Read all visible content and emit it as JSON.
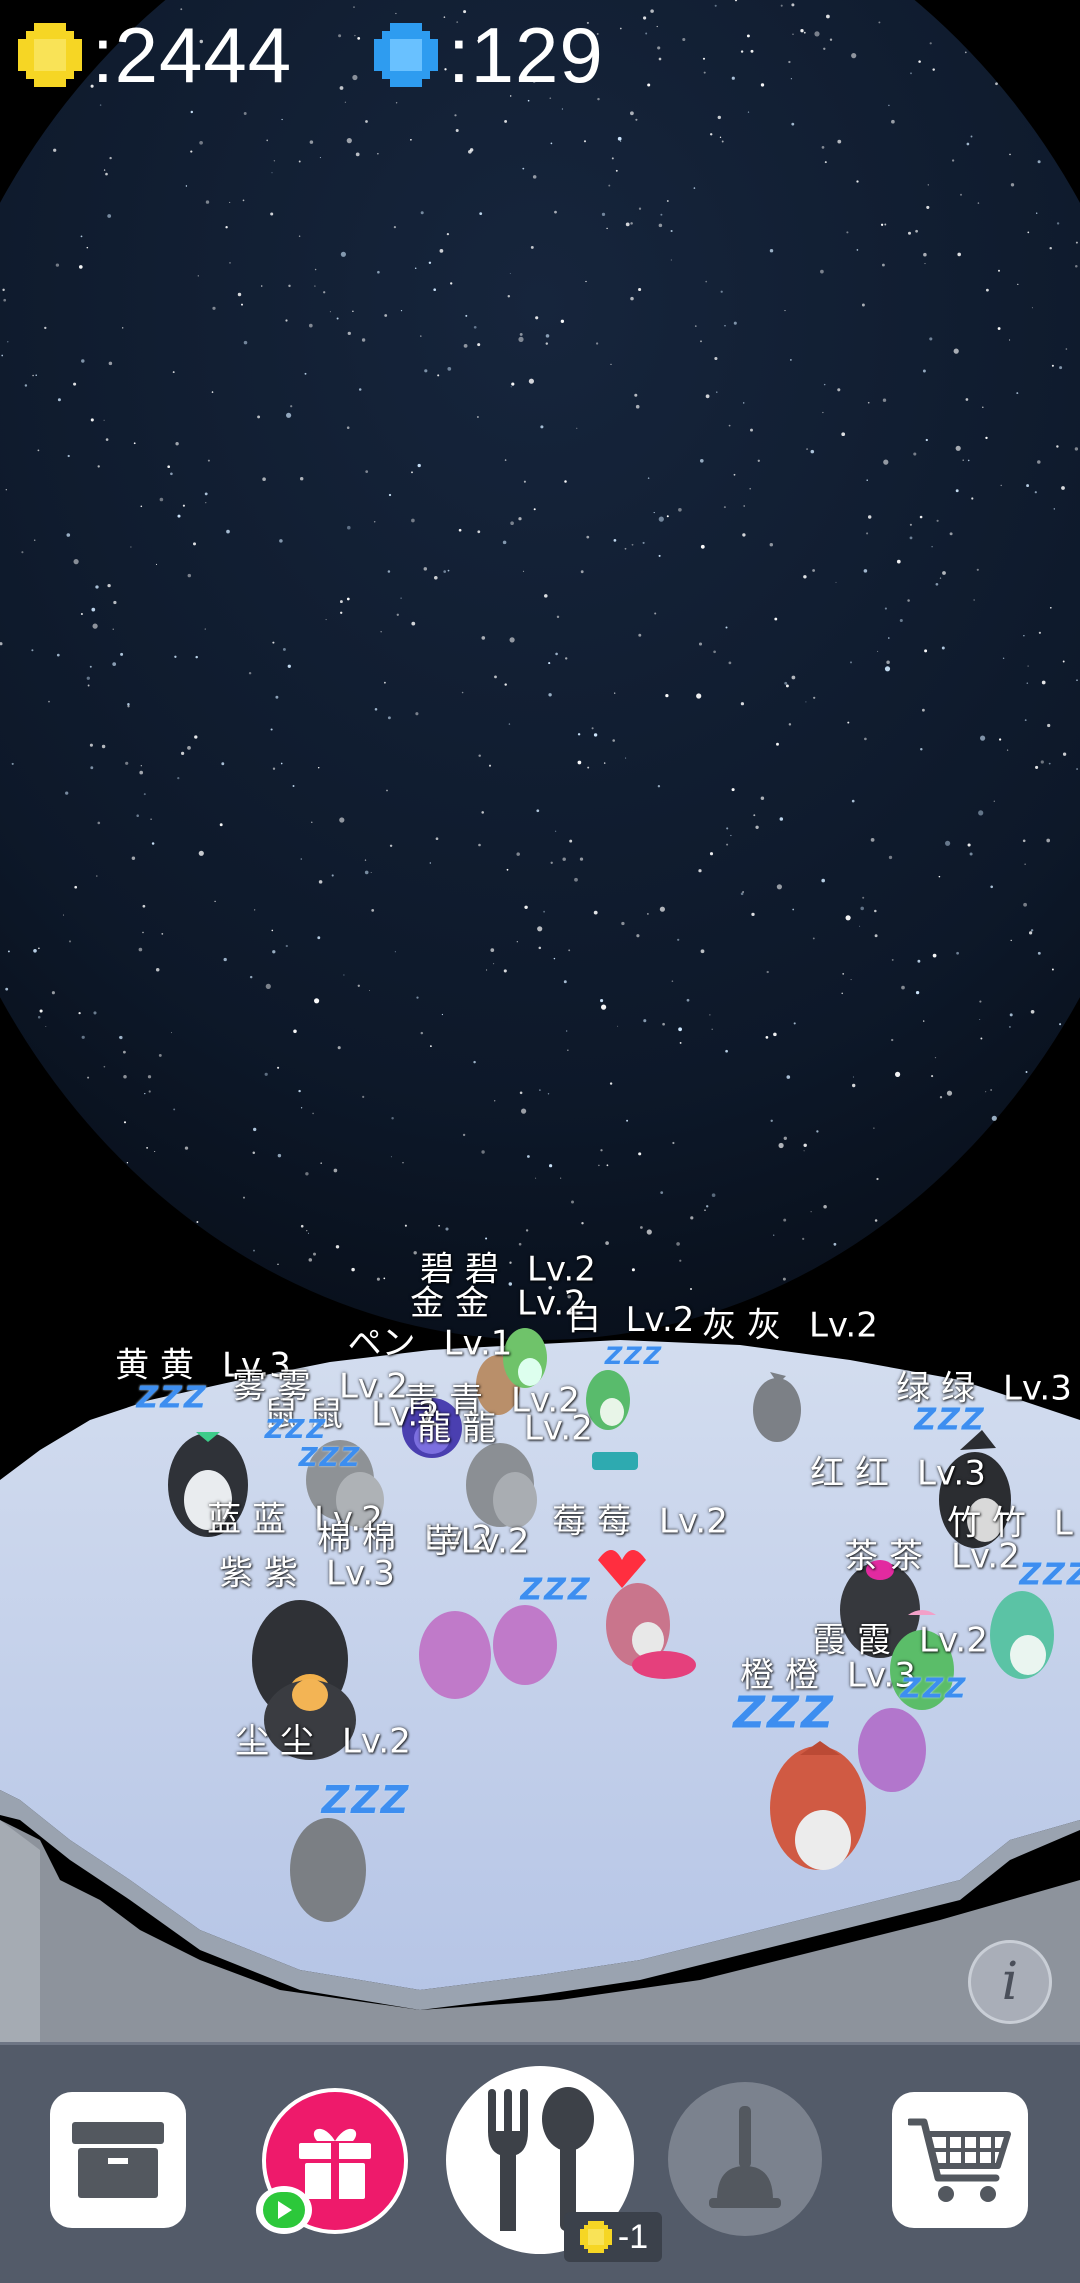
{
  "hud": {
    "coins": ":2444",
    "gems": ":129"
  },
  "colors": {
    "coin": "#f6d624",
    "gem": "#2e9cf0",
    "floor": "#c5d3ee",
    "toolbar": "#535b69",
    "gift": "#ee1a6b",
    "zzz": "#3d8ef0"
  },
  "labels": [
    {
      "id": "bibi",
      "name": "碧 碧",
      "level": "Lv.2"
    },
    {
      "id": "jinjin",
      "name": "金 金",
      "level": "Lv.2"
    },
    {
      "id": "bai",
      "name": "白",
      "level": ""
    },
    {
      "id": "hui_lv",
      "name": "",
      "level": "Lv.2"
    },
    {
      "id": "huihui",
      "name": "灰 灰",
      "level": "Lv.2"
    },
    {
      "id": "pen",
      "name": "ペン",
      "level": "Lv.1"
    },
    {
      "id": "huanghuang",
      "name": "黄 黄",
      "level": "Lv.3"
    },
    {
      "id": "wuwu",
      "name": "雾 雾",
      "level": "Lv.2"
    },
    {
      "id": "qingqing",
      "name": "青 青",
      "level": "Lv.2"
    },
    {
      "id": "lvlv",
      "name": "绿 绿",
      "level": "Lv.3"
    },
    {
      "id": "shushu",
      "name": "鼠 鼠",
      "level": "Lv.2"
    },
    {
      "id": "longlong",
      "name": "龍 龍",
      "level": "Lv.2"
    },
    {
      "id": "honghong",
      "name": "红 红",
      "level": "Lv.3"
    },
    {
      "id": "lanlan",
      "name": "蓝 蓝",
      "level": "Lv.2"
    },
    {
      "id": "mianmian",
      "name": "棉 棉",
      "level": "Lv.2"
    },
    {
      "id": "yuyu",
      "name": "芋",
      "level": "Lv.2"
    },
    {
      "id": "meimei",
      "name": "莓 莓",
      "level": "Lv.2"
    },
    {
      "id": "zhuzhu",
      "name": "竹 竹",
      "level": "L"
    },
    {
      "id": "chacha",
      "name": "茶 茶",
      "level": "Lv.2"
    },
    {
      "id": "zizi",
      "name": "紫 紫",
      "level": "Lv.3"
    },
    {
      "id": "xiaxia",
      "name": "霞 霞",
      "level": "Lv.2"
    },
    {
      "id": "chengcheng",
      "name": "橙 橙",
      "level": "Lv.3"
    },
    {
      "id": "chenchen",
      "name": "尘 尘",
      "level": "Lv.2"
    }
  ],
  "sleep": "ZZZ",
  "info_icon": "i",
  "toolbar": {
    "storage": "archive-box-icon",
    "gift": "gift-icon",
    "feed": "fork-spoon-icon",
    "feed_cost": "-1",
    "clean": "plunger-icon",
    "shop": "cart-icon",
    "video": "play-video-icon"
  }
}
